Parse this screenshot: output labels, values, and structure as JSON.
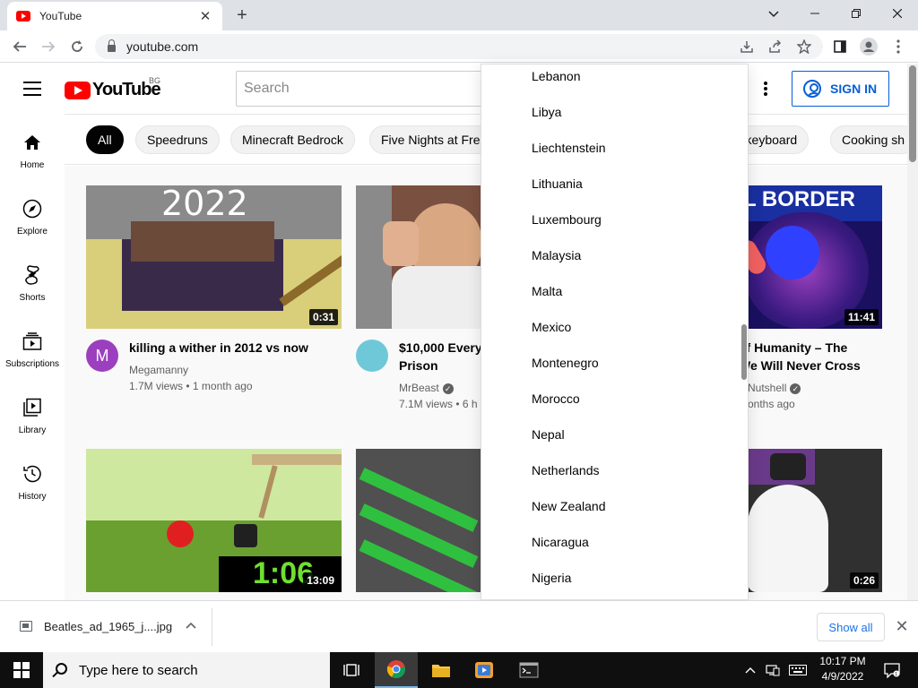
{
  "browser": {
    "tab_title": "YouTube",
    "tab_close": "✕",
    "new_tab": "+",
    "url": "youtube.com",
    "window_controls": {
      "dropdown": "⌄",
      "minimize": "—",
      "restore": "❐",
      "close": "✕"
    }
  },
  "header": {
    "logo_text": "YouTube",
    "country_code": "BG",
    "search_placeholder": "Search",
    "signin_label": "SIGN IN"
  },
  "guide": [
    {
      "label": "Home",
      "icon": "home-icon"
    },
    {
      "label": "Explore",
      "icon": "compass-icon"
    },
    {
      "label": "Shorts",
      "icon": "shorts-icon"
    },
    {
      "label": "Subscriptions",
      "icon": "subscriptions-icon"
    },
    {
      "label": "Library",
      "icon": "library-icon"
    },
    {
      "label": "History",
      "icon": "history-icon"
    }
  ],
  "chips": [
    "All",
    "Speedruns",
    "Minecraft Bedrock",
    "Five Nights at Freddy's",
    "r keyboard",
    "Cooking sh"
  ],
  "videos": [
    {
      "title_lines": [
        "killing a wither in 2012 vs now",
        ""
      ],
      "channel": "Megamanny",
      "stats": "1.7M views • 1 month ago",
      "duration": "0:31",
      "avatar_letter": "M",
      "thumb_text": "2022"
    },
    {
      "title_lines": [
        "$10,000 Every",
        "Prison"
      ],
      "channel": "MrBeast",
      "stats": "7.1M views • 6 h",
      "duration": "",
      "avatar_letter": "",
      "thumb_text": ""
    },
    {
      "title_lines": [
        "of Humanity – The",
        "We Will Never Cross"
      ],
      "channel": "a Nutshell",
      "stats": "months ago",
      "duration": "11:41",
      "avatar_letter": "",
      "thumb_text": "L BORDER"
    },
    {
      "title_lines": [
        "",
        ""
      ],
      "channel": "",
      "stats": "",
      "duration": "13:09",
      "avatar_letter": "",
      "thumb_text": "1:06"
    },
    {
      "title_lines": [
        "",
        ""
      ],
      "channel": "",
      "stats": "",
      "duration": "",
      "avatar_letter": "",
      "thumb_text": ""
    },
    {
      "title_lines": [
        "",
        ""
      ],
      "channel": "",
      "stats": "",
      "duration": "0:26",
      "avatar_letter": "",
      "thumb_text": ""
    }
  ],
  "country_menu": [
    "Lebanon",
    "Libya",
    "Liechtenstein",
    "Lithuania",
    "Luxembourg",
    "Malaysia",
    "Malta",
    "Mexico",
    "Montenegro",
    "Morocco",
    "Nepal",
    "Netherlands",
    "New Zealand",
    "Nicaragua",
    "Nigeria"
  ],
  "download_bar": {
    "file_name": "Beatles_ad_1965_j....jpg",
    "show_all": "Show all",
    "close": "✕"
  },
  "taskbar": {
    "search_placeholder": "Type here to search",
    "time": "10:17 PM",
    "date": "4/9/2022"
  },
  "colors": {
    "youtube_red": "#ff0000",
    "signin_blue": "#065fd4",
    "chip_active": "#030303"
  }
}
